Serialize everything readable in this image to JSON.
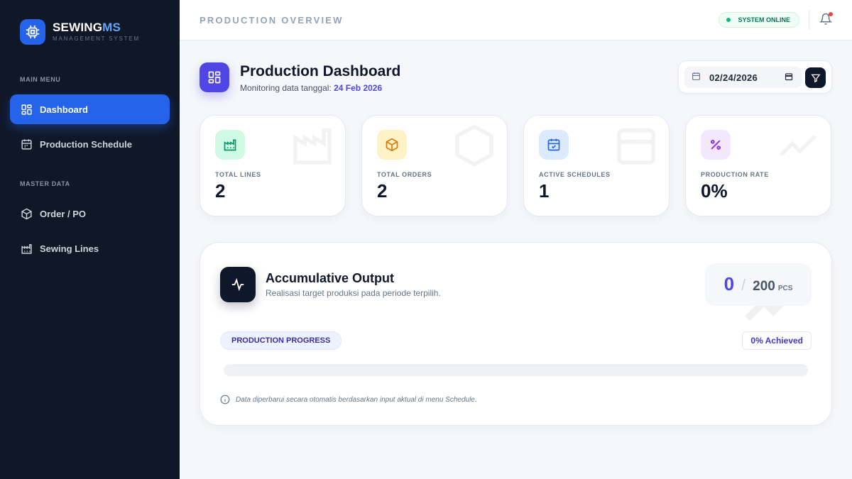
{
  "brand": {
    "name_main": "SEWING",
    "name_accent": "MS",
    "subtitle": "MANAGEMENT SYSTEM"
  },
  "sidebar": {
    "main_menu_label": "MAIN MENU",
    "master_data_label": "MASTER DATA",
    "items": [
      {
        "label": "Dashboard",
        "icon": "grid-icon",
        "active": true
      },
      {
        "label": "Production Schedule",
        "icon": "calendar-icon",
        "active": false
      },
      {
        "label": "Order / PO",
        "icon": "box-icon",
        "active": false
      },
      {
        "label": "Sewing Lines",
        "icon": "factory-icon",
        "active": false
      }
    ]
  },
  "topbar": {
    "title": "PRODUCTION OVERVIEW",
    "status": "SYSTEM ONLINE"
  },
  "header": {
    "title": "Production Dashboard",
    "subtitle_prefix": "Monitoring data tanggal:",
    "subtitle_date": "24 Feb 2026",
    "date_value": "02/24/2026"
  },
  "stats": [
    {
      "label": "TOTAL LINES",
      "value": "2",
      "icon": "factory-icon",
      "color": "#059669",
      "bg": "#d1fae5"
    },
    {
      "label": "TOTAL ORDERS",
      "value": "2",
      "icon": "box-icon",
      "color": "#d97706",
      "bg": "#fef3c7"
    },
    {
      "label": "ACTIVE SCHEDULES",
      "value": "1",
      "icon": "calendar-check-icon",
      "color": "#2563eb",
      "bg": "#dbeafe"
    },
    {
      "label": "PRODUCTION RATE",
      "value": "0%",
      "icon": "percent-icon",
      "color": "#9333ea",
      "bg": "#f3e8ff"
    }
  ],
  "output": {
    "title": "Accumulative Output",
    "subtitle": "Realisasi target produksi pada periode terpilih.",
    "current": "0",
    "target": "200",
    "unit": "PCS",
    "progress_label": "PRODUCTION PROGRESS",
    "achieved": "0% Achieved",
    "progress_fraction": 0,
    "note": "Data diperbarui secara otomatis berdasarkan input aktual di menu Schedule."
  }
}
